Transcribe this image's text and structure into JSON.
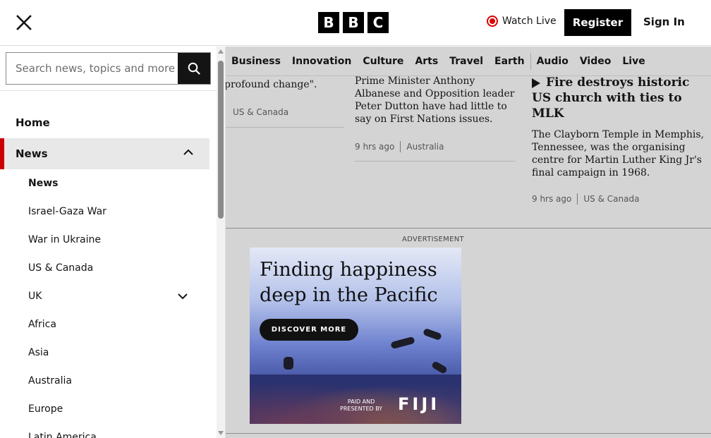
{
  "header": {
    "logo_letters": [
      "B",
      "B",
      "C"
    ],
    "watch_live": "Watch Live",
    "register": "Register",
    "sign_in": "Sign In"
  },
  "drawer": {
    "search_placeholder": "Search news, topics and more",
    "home": "Home",
    "news": "News",
    "sub_items": [
      "News",
      "Israel-Gaza War",
      "War in Ukraine",
      "US & Canada",
      "UK",
      "Africa",
      "Asia",
      "Australia",
      "Europe",
      "Latin America"
    ]
  },
  "topnav": [
    "Business",
    "Innovation",
    "Culture",
    "Arts",
    "Travel",
    "Earth",
    "Audio",
    "Video",
    "Live"
  ],
  "stories": {
    "col1": {
      "fragment": "profound change\".",
      "tag": "US & Canada"
    },
    "col2": {
      "body": "Prime Minister Anthony Albanese and Opposition leader Peter Dutton have had little to say on First Nations issues.",
      "time": "9 hrs ago",
      "tag": "Australia"
    },
    "col3": {
      "title": "Fire destroys historic US church with ties to MLK",
      "body": "The Clayborn Temple in Memphis, Tennessee, was the organising centre for Martin Luther King Jr's final campaign in 1968.",
      "time": "9 hrs ago",
      "tag": "US & Canada"
    }
  },
  "ad": {
    "label": "ADVERTISEMENT",
    "headline": "Finding happiness deep in the Pacific",
    "cta": "DISCOVER MORE",
    "paid_line1": "PAID AND",
    "paid_line2": "PRESENTED BY",
    "brand": "FIJI"
  },
  "colors": {
    "accent_red": "#cc0000",
    "brand_black": "#000000"
  }
}
